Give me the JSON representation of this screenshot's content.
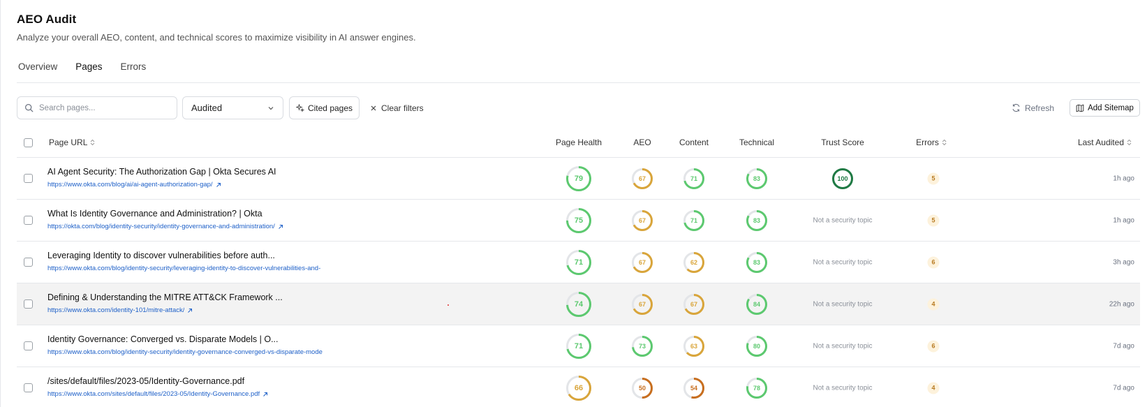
{
  "header": {
    "title": "AEO Audit",
    "subtitle": "Analyze your overall AEO, content, and technical scores to maximize visibility in AI answer engines."
  },
  "tabs": [
    {
      "label": "Overview",
      "active": false
    },
    {
      "label": "Pages",
      "active": true
    },
    {
      "label": "Errors",
      "active": false
    }
  ],
  "toolbar": {
    "search_placeholder": "Search pages...",
    "filter_value": "Audited",
    "cited_label": "Cited pages",
    "clear_label": "Clear filters",
    "refresh_label": "Refresh",
    "sitemap_label": "Add Sitemap"
  },
  "columns": {
    "page_url": "Page URL",
    "page_health": "Page Health",
    "aeo": "AEO",
    "content": "Content",
    "technical": "Technical",
    "trust_score": "Trust Score",
    "errors": "Errors",
    "last_audited": "Last Audited"
  },
  "colors": {
    "green": "#5cc96f",
    "amber": "#d9a53a",
    "orange": "#c86e1e",
    "dark_green": "#1f7a44",
    "track": "#e3e5e8",
    "link": "#1e60c8"
  },
  "rows": [
    {
      "title": "AI Agent Security: The Authorization Gap | Okta Secures AI",
      "url": "https://www.okta.com/blog/ai/ai-agent-authorization-gap/",
      "external": true,
      "health": 79,
      "aeo": 67,
      "content": 71,
      "technical": 83,
      "trust": 100,
      "trust_text": null,
      "errors": 5,
      "last": "1h ago",
      "highlight": false
    },
    {
      "title": "What Is Identity Governance and Administration? | Okta",
      "url": "https://okta.com/blog/identity-security/identity-governance-and-administration/",
      "external": true,
      "health": 75,
      "aeo": 67,
      "content": 71,
      "technical": 83,
      "trust": null,
      "trust_text": "Not a security topic",
      "errors": 5,
      "last": "1h ago",
      "highlight": false
    },
    {
      "title": "Leveraging Identity to discover vulnerabilities before auth...",
      "url": "https://www.okta.com/blog/identity-security/leveraging-identity-to-discover-vulnerabilities-and-",
      "external": false,
      "health": 71,
      "aeo": 67,
      "content": 62,
      "technical": 83,
      "trust": null,
      "trust_text": "Not a security topic",
      "errors": 6,
      "last": "3h ago",
      "highlight": false
    },
    {
      "title": "Defining & Understanding the MITRE ATT&CK Framework ...",
      "url": "https://www.okta.com/identity-101/mitre-attack/",
      "external": true,
      "health": 74,
      "aeo": 67,
      "content": 67,
      "technical": 84,
      "trust": null,
      "trust_text": "Not a security topic",
      "errors": 4,
      "last": "22h ago",
      "highlight": true
    },
    {
      "title": "Identity Governance: Converged vs. Disparate Models | O...",
      "url": "https://www.okta.com/blog/identity-security/identity-governance-converged-vs-disparate-mode",
      "external": false,
      "health": 71,
      "aeo": 73,
      "content": 63,
      "technical": 80,
      "trust": null,
      "trust_text": "Not a security topic",
      "errors": 6,
      "last": "7d ago",
      "highlight": false
    },
    {
      "title": "/sites/default/files/2023-05/Identity-Governance.pdf",
      "url": "https://www.okta.com/sites/default/files/2023-05/Identity-Governance.pdf",
      "external": true,
      "health": 66,
      "aeo": 50,
      "content": 54,
      "technical": 78,
      "trust": null,
      "trust_text": "Not a security topic",
      "errors": 4,
      "last": "7d ago",
      "highlight": false
    }
  ]
}
